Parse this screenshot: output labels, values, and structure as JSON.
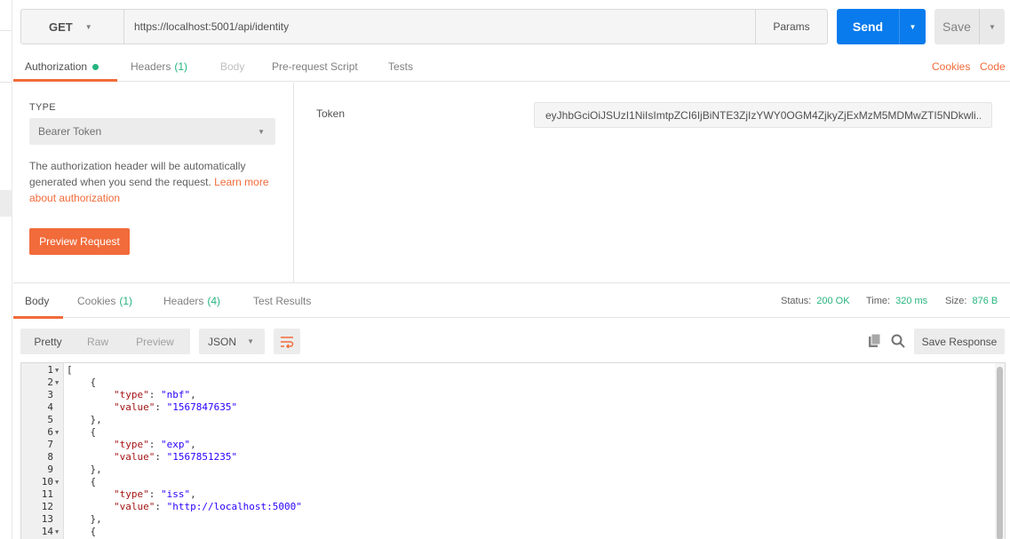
{
  "request": {
    "method": "GET",
    "url": "https://localhost:5001/api/identity",
    "params_label": "Params",
    "send_label": "Send",
    "save_label": "Save"
  },
  "request_tabs": [
    {
      "label": "Authorization",
      "count": ""
    },
    {
      "label": "Headers",
      "count": "(1)"
    },
    {
      "label": "Body",
      "count": ""
    },
    {
      "label": "Pre-request Script",
      "count": ""
    },
    {
      "label": "Tests",
      "count": ""
    }
  ],
  "links": {
    "cookies": "Cookies",
    "code": "Code"
  },
  "auth": {
    "type_label": "TYPE",
    "type_value": "Bearer Token",
    "description": "The authorization header will be automatically generated when you send the request. ",
    "learn_more": "Learn more about authorization",
    "preview_label": "Preview Request",
    "token_label": "Token",
    "token_value": "eyJhbGciOiJSUzI1NiIsImtpZCI6IjBiNTE3ZjIzYWY0OGM4ZjkyZjExMzM5MDMwZTI5NDkwli..."
  },
  "response_tabs": [
    {
      "label": "Body",
      "count": ""
    },
    {
      "label": "Cookies",
      "count": "(1)"
    },
    {
      "label": "Headers",
      "count": "(4)"
    },
    {
      "label": "Test Results",
      "count": ""
    }
  ],
  "status": {
    "status_label": "Status:",
    "status_value": "200 OK",
    "time_label": "Time:",
    "time_value": "320 ms",
    "size_label": "Size:",
    "size_value": "876 B"
  },
  "view": {
    "formats": [
      "Pretty",
      "Raw",
      "Preview"
    ],
    "active_format": "Pretty",
    "language": "JSON",
    "save_response_label": "Save Response"
  },
  "icons": {
    "wrap": "wrap-lines-icon",
    "copy": "copy-icon",
    "search": "search-icon"
  },
  "colors": {
    "accent": "#f26b3a",
    "send": "#097bed",
    "success": "#26b47f"
  },
  "code_lines": [
    {
      "n": "1",
      "fold": true,
      "text": "["
    },
    {
      "n": "2",
      "fold": true,
      "text": "    {"
    },
    {
      "n": "3",
      "fold": false,
      "key": "\"type\"",
      "val": "\"nbf\"",
      "end": ","
    },
    {
      "n": "4",
      "fold": false,
      "key": "\"value\"",
      "val": "\"1567847635\"",
      "end": ""
    },
    {
      "n": "5",
      "fold": false,
      "text": "    },"
    },
    {
      "n": "6",
      "fold": true,
      "text": "    {"
    },
    {
      "n": "7",
      "fold": false,
      "key": "\"type\"",
      "val": "\"exp\"",
      "end": ","
    },
    {
      "n": "8",
      "fold": false,
      "key": "\"value\"",
      "val": "\"1567851235\"",
      "end": ""
    },
    {
      "n": "9",
      "fold": false,
      "text": "    },"
    },
    {
      "n": "10",
      "fold": true,
      "text": "    {"
    },
    {
      "n": "11",
      "fold": false,
      "key": "\"type\"",
      "val": "\"iss\"",
      "end": ","
    },
    {
      "n": "12",
      "fold": false,
      "key": "\"value\"",
      "val": "\"http://localhost:5000\"",
      "end": ""
    },
    {
      "n": "13",
      "fold": false,
      "text": "    },"
    },
    {
      "n": "14",
      "fold": true,
      "text": "    {"
    }
  ]
}
